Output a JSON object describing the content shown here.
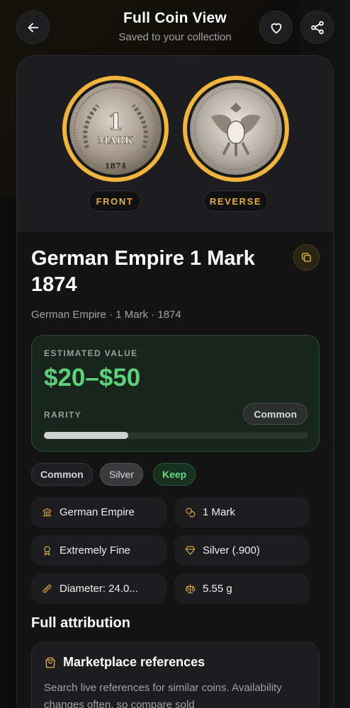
{
  "header": {
    "title": "Full Coin View",
    "subtitle": "Saved to your collection",
    "back_icon": "arrow-left-icon",
    "favorite_icon": "heart-icon",
    "share_icon": "share-icon"
  },
  "images": {
    "front_label": "FRONT",
    "reverse_label": "REVERSE"
  },
  "coin": {
    "title": "German Empire 1 Mark 1874",
    "meta": "German Empire · 1 Mark · 1874",
    "copy_icon": "copy-icon"
  },
  "value": {
    "caption": "ESTIMATED VALUE",
    "amount": "$20–$50",
    "rarity_caption": "RARITY",
    "rarity_label": "Common",
    "rarity_level": 0.32,
    "accent": "#5dd07b"
  },
  "tags": [
    "Common",
    "Silver",
    "Keep"
  ],
  "attributes": [
    {
      "icon": "bank-icon",
      "text": "German Empire"
    },
    {
      "icon": "coins-icon",
      "text": "1 Mark"
    },
    {
      "icon": "award-icon",
      "text": "Extremely Fine"
    },
    {
      "icon": "gem-icon",
      "text": "Silver (.900)"
    },
    {
      "icon": "ruler-icon",
      "text": "Diameter: 24.0..."
    },
    {
      "icon": "scale-icon",
      "text": "5.55 g"
    }
  ],
  "full_attribution": {
    "heading": "Full attribution"
  },
  "marketplace": {
    "icon": "shopping-bag-icon",
    "title": "Marketplace references",
    "description": "Search live references for similar coins. Availability changes often, so compare sold"
  },
  "colors": {
    "gold_accent": "#e2ad48",
    "coin_ring": "#f0b43f",
    "value_green": "#5dd07b"
  }
}
